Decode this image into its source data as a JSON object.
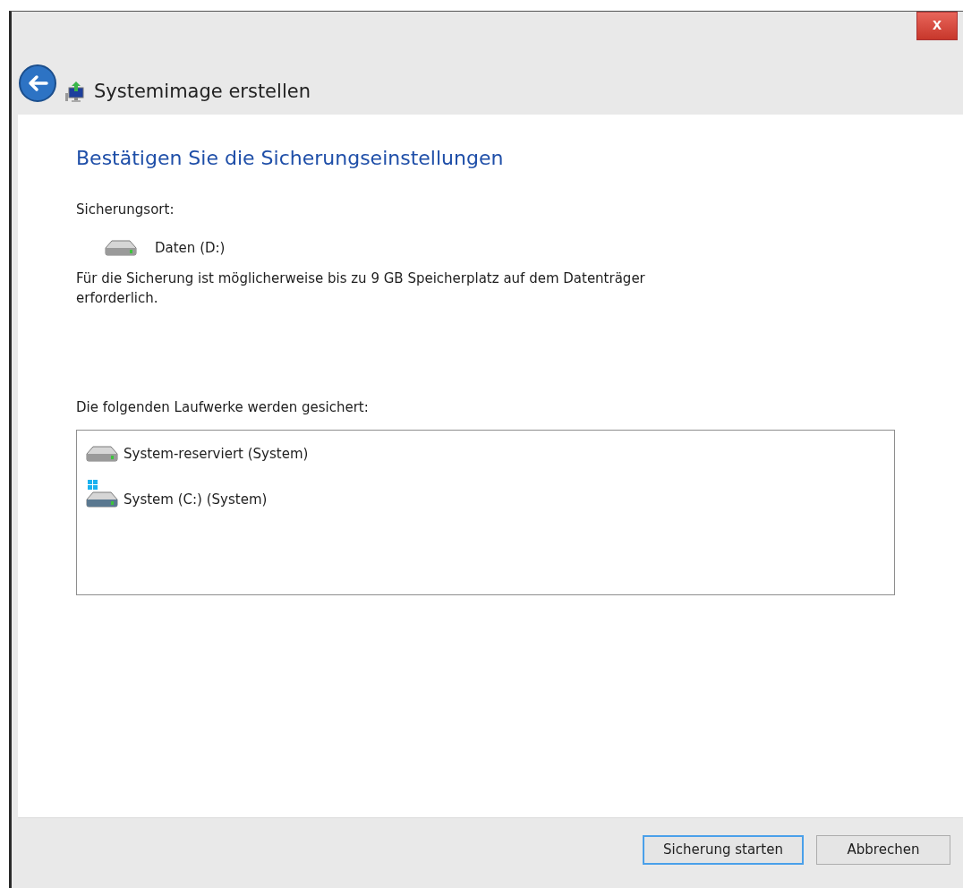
{
  "window": {
    "title": "Systemimage erstellen",
    "close": "x"
  },
  "heading": "Bestätigen Sie die Sicherungseinstellungen",
  "location": {
    "label": "Sicherungsort:",
    "drive": {
      "name": "Daten (D:)",
      "kind": "data"
    }
  },
  "note": "Für die Sicherung ist möglicherweise bis zu 9 GB Speicherplatz auf dem Datenträger erforderlich.",
  "drives_label": "Die folgenden Laufwerke werden gesichert:",
  "drives": [
    {
      "name": "System-reserviert (System)",
      "kind": "data"
    },
    {
      "name": "System (C:) (System)",
      "kind": "system"
    }
  ],
  "buttons": [
    {
      "label": "Sicherung starten",
      "default": true
    },
    {
      "label": "Abbrechen",
      "default": false
    }
  ]
}
